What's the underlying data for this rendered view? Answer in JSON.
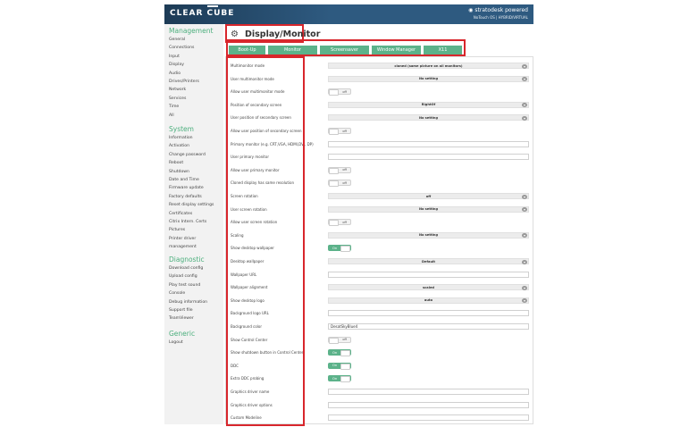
{
  "header": {
    "logo": "CLEAR CUBE",
    "powered": "stratodesk powered",
    "powered_sub": "NoTouch OS | HYBRID/VIRTUAL"
  },
  "page": {
    "title": "Display/Monitor",
    "icon": "gears-icon"
  },
  "sidebar": {
    "sections": [
      {
        "title": "Management",
        "items": [
          "General",
          "Connections",
          "Input",
          "Display",
          "Audio",
          "Drives/Printers",
          "Network",
          "Services",
          "Time",
          "All"
        ]
      },
      {
        "title": "System",
        "items": [
          "Information",
          "Activation",
          "Change password",
          "Reboot",
          "Shutdown",
          "Date and Time",
          "Firmware update",
          "Factory defaults",
          "Reset display settings",
          "Certificates",
          "Citrix Intern. Certs",
          "Pictures",
          "Printer driver",
          "management"
        ]
      },
      {
        "title": "Diagnostic",
        "items": [
          "Download config",
          "Upload config",
          "Play test sound",
          "Console",
          "Debug information",
          "Support file",
          "TeamViewer"
        ]
      },
      {
        "title": "Generic",
        "items": [
          "Logout"
        ]
      }
    ]
  },
  "tabs": [
    "Boot-Up",
    "Monitor",
    "Screensaver",
    "Window Manager",
    "X11"
  ],
  "settings": [
    {
      "label": "Multimonitor mode",
      "type": "select",
      "value": "cloned (same picture on all monitors)"
    },
    {
      "label": "User multimonitor mode",
      "type": "select",
      "value": "No setting"
    },
    {
      "label": "Allow user multimonitor mode",
      "type": "toggle",
      "state": "off"
    },
    {
      "label": "Position of secondary screen",
      "type": "select",
      "value": "RightOf"
    },
    {
      "label": "User position of secondary screen",
      "type": "select",
      "value": "No setting"
    },
    {
      "label": "Allow user position of secondary screen",
      "type": "toggle",
      "state": "off"
    },
    {
      "label": "Primary monitor (e.g. CRT,VGA, HDMI,DVI, DP)",
      "type": "input",
      "value": ""
    },
    {
      "label": "User primary monitor",
      "type": "input",
      "value": ""
    },
    {
      "label": "Allow user primary monitor",
      "type": "toggle",
      "state": "off"
    },
    {
      "label": "Cloned display has same resolution",
      "type": "toggle",
      "state": "off"
    },
    {
      "label": "Screen rotation",
      "type": "select",
      "value": "off"
    },
    {
      "label": "User screen rotation",
      "type": "select",
      "value": "No setting"
    },
    {
      "label": "Allow user screen rotation",
      "type": "toggle",
      "state": "off"
    },
    {
      "label": "Scaling",
      "type": "select",
      "value": "No setting"
    },
    {
      "label": "Show desktop wallpaper",
      "type": "toggle",
      "state": "on"
    },
    {
      "label": "Desktop wallpaper",
      "type": "select",
      "value": "Default"
    },
    {
      "label": "Wallpaper URL",
      "type": "input",
      "value": ""
    },
    {
      "label": "Wallpaper alignment",
      "type": "select",
      "value": "scaled"
    },
    {
      "label": "Show desktop logo",
      "type": "select",
      "value": "auto"
    },
    {
      "label": "Background logo URL",
      "type": "input",
      "value": ""
    },
    {
      "label": "Background color",
      "type": "input",
      "value": "DesatSkyBlue4"
    },
    {
      "label": "Show Control Center",
      "type": "toggle",
      "state": "off"
    },
    {
      "label": "Show shutdown button in Control Center",
      "type": "toggle",
      "state": "on"
    },
    {
      "label": "DDC",
      "type": "toggle",
      "state": "on"
    },
    {
      "label": "Extra DDC probing",
      "type": "toggle",
      "state": "on"
    },
    {
      "label": "Graphics driver name",
      "type": "input",
      "value": ""
    },
    {
      "label": "Graphics driver options",
      "type": "input",
      "value": ""
    },
    {
      "label": "Custom Modeline",
      "type": "input",
      "value": ""
    }
  ],
  "toggle_text": {
    "on": "On",
    "off": "off"
  },
  "colors": {
    "accent": "#5cb28a",
    "highlight": "#d8262c",
    "header": "#2e5a80"
  }
}
